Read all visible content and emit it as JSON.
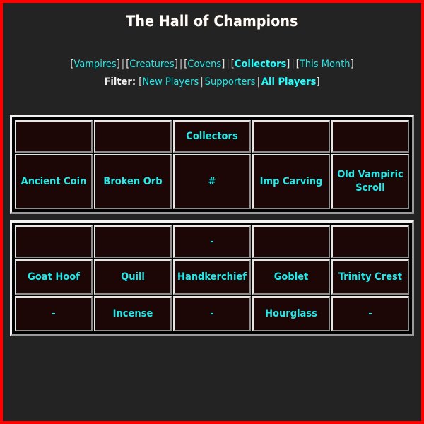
{
  "header": {
    "title": "The Hall of Champions"
  },
  "nav": {
    "open_bracket": "[",
    "close_bracket": "]",
    "separator": "|",
    "items": [
      {
        "label": "Vampires",
        "active": false
      },
      {
        "label": "Creatures",
        "active": false
      },
      {
        "label": "Covens",
        "active": false
      },
      {
        "label": "Collectors",
        "active": true
      },
      {
        "label": "This Month",
        "active": false
      }
    ]
  },
  "filter": {
    "label": "Filter:",
    "open_bracket": "[",
    "close_bracket": "]",
    "separator": "|",
    "items": [
      {
        "label": "New Players",
        "active": false
      },
      {
        "label": "Supporters",
        "active": false
      },
      {
        "label": "All Players",
        "active": true
      }
    ]
  },
  "tables": [
    {
      "name": "collectors-top-table",
      "rows": [
        {
          "type": "header",
          "cells": [
            {
              "text": "",
              "style": "blank"
            },
            {
              "text": "",
              "style": "blank"
            },
            {
              "text": "Collectors",
              "style": "title"
            },
            {
              "text": "",
              "style": "blank"
            },
            {
              "text": "",
              "style": "blank"
            }
          ]
        },
        {
          "type": "items",
          "cells": [
            {
              "text": "Ancient Coin",
              "style": "item"
            },
            {
              "text": "Broken Orb",
              "style": "item"
            },
            {
              "text": "#",
              "style": "hash"
            },
            {
              "text": "Imp Carving",
              "style": "item"
            },
            {
              "text": "Old Vampiric Scroll",
              "style": "item"
            }
          ]
        }
      ]
    },
    {
      "name": "collectors-bottom-table",
      "rows": [
        {
          "type": "header",
          "cells": [
            {
              "text": "",
              "style": "blank"
            },
            {
              "text": "",
              "style": "blank"
            },
            {
              "text": "-",
              "style": "dash"
            },
            {
              "text": "",
              "style": "blank"
            },
            {
              "text": "",
              "style": "blank"
            }
          ]
        },
        {
          "type": "items",
          "cells": [
            {
              "text": "Goat Hoof",
              "style": "item"
            },
            {
              "text": "Quill",
              "style": "item"
            },
            {
              "text": "Handkerchief",
              "style": "item"
            },
            {
              "text": "Goblet",
              "style": "item"
            },
            {
              "text": "Trinity Crest",
              "style": "item"
            }
          ]
        },
        {
          "type": "items",
          "cells": [
            {
              "text": "-",
              "style": "dash"
            },
            {
              "text": "Incense",
              "style": "item"
            },
            {
              "text": "-",
              "style": "dash"
            },
            {
              "text": "Hourglass",
              "style": "item"
            },
            {
              "text": "-",
              "style": "dash"
            }
          ]
        }
      ]
    }
  ],
  "colors": {
    "page_background": "#232323",
    "outer_border": "#ff0000",
    "cell_background": "#1c0606",
    "link_cyan": "#25e8e8",
    "active_cyan": "#25ffff",
    "text_white": "#ffffff",
    "cell_border_light": "#e6e6e6",
    "cell_border_dark": "#8c8c8c"
  }
}
